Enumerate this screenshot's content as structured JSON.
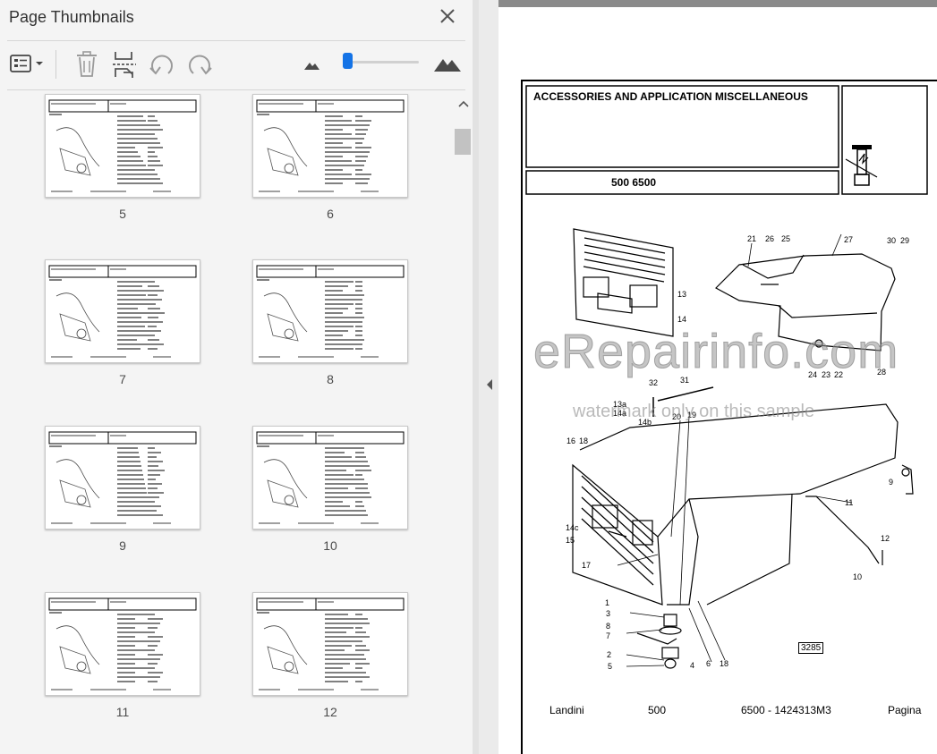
{
  "panel": {
    "title": "Page Thumbnails"
  },
  "toolbar": {
    "options_icon": "thumbnail-options-icon",
    "delete_icon": "trash-icon",
    "extract_icon": "extract-pages-icon",
    "rotate_ccw_icon": "rotate-counterclockwise-icon",
    "rotate_cw_icon": "rotate-clockwise-icon",
    "zoom_out_icon": "small-mountain-icon",
    "zoom_in_icon": "large-mountain-icon",
    "zoom_level": 0.05
  },
  "thumbnails": [
    {
      "page": "5"
    },
    {
      "page": "6"
    },
    {
      "page": "7"
    },
    {
      "page": "8"
    },
    {
      "page": "9"
    },
    {
      "page": "10"
    },
    {
      "page": "11"
    },
    {
      "page": "12"
    }
  ],
  "document": {
    "heading": "ACCESSORIES AND APPLICATION MISCELLANEOUS",
    "model": "500 6500",
    "drawing_ref": "3285",
    "watermark": "eRepairinfo.com",
    "watermark_sub": "watermark only on this sample",
    "footer": {
      "brand": "Landini",
      "model": "500",
      "code": "6500 - 1424313M3",
      "page_label": "Pagina"
    },
    "callouts": [
      "21",
      "26",
      "25",
      "27",
      "30",
      "29",
      "13",
      "14",
      "24",
      "23",
      "22",
      "28",
      "32",
      "31",
      "13a",
      "14a",
      "14b",
      "20",
      "19",
      "16",
      "18",
      "9",
      "11",
      "12",
      "10",
      "14c",
      "15",
      "17",
      "1",
      "3",
      "8",
      "7",
      "2",
      "5",
      "4",
      "6",
      "18"
    ]
  },
  "colors": {
    "accent": "#1473e6",
    "panel_bg": "#f4f4f4"
  }
}
